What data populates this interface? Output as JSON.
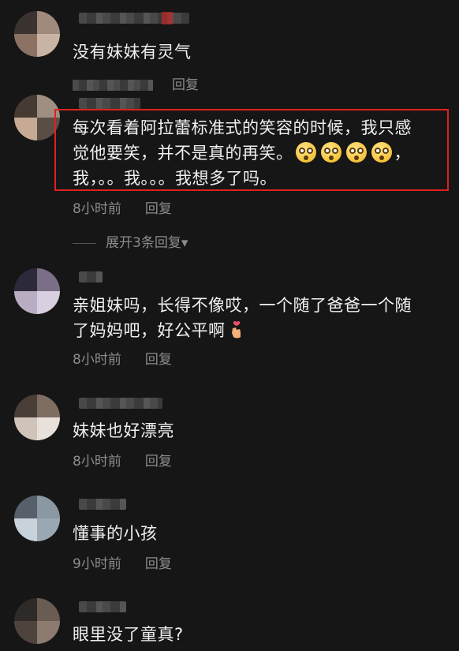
{
  "comments": [
    {
      "text": "没有妹妹有灵气",
      "time": "",
      "reply": "回复"
    },
    {
      "text_line1": "每次看着阿拉蕾标准式的笑容的时候，我只感",
      "text_line2a": "觉他要笑，并不是真的再笑。",
      "text_line2b": "，",
      "text_line3": "我，。。我。。。我想多了吗。",
      "time": "8小时前",
      "reply": "回复",
      "expand": "展开3条回复▾",
      "emoji_icon": "astonished-face-icon"
    },
    {
      "text_line1": "亲姐妹吗，长得不像哎，一个随了爸爸一个随",
      "text_line2": "了妈妈吧，好公平啊",
      "emoji_icon": "finger-heart-icon",
      "time": "8小时前",
      "reply": "回复"
    },
    {
      "text": "妹妹也好漂亮",
      "time": "8小时前",
      "reply": "回复"
    },
    {
      "text": "懂事的小孩",
      "time": "9小时前",
      "reply": "回复"
    },
    {
      "text": "眼里没了童真?"
    }
  ],
  "highlight_color": "#e02020"
}
